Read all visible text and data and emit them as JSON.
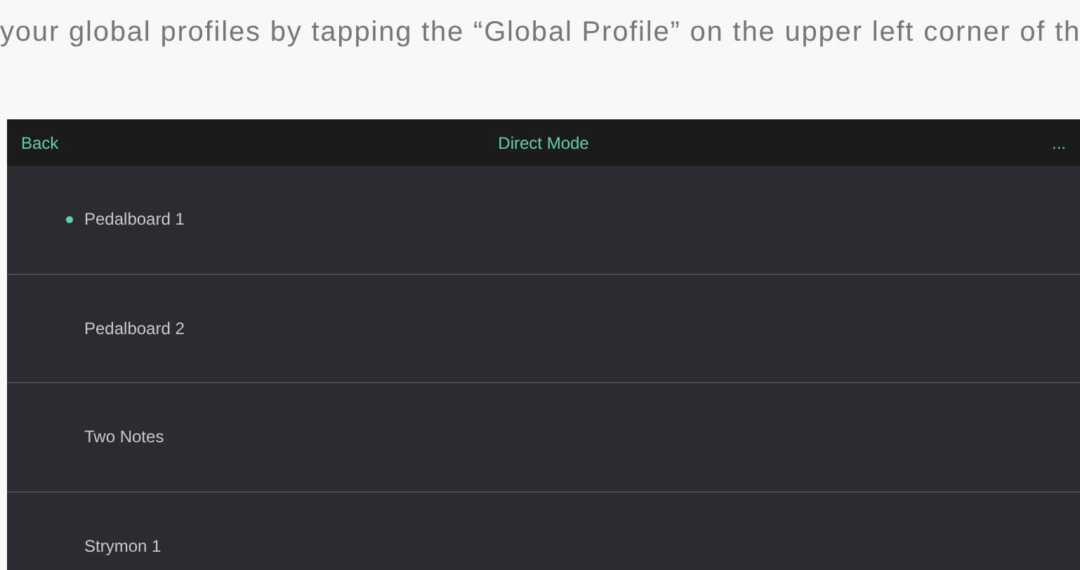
{
  "caption": "your global profiles by tapping the “Global Profile” on the upper left corner of th",
  "header": {
    "back": "Back",
    "title": "Direct Mode",
    "more": "..."
  },
  "profiles": [
    {
      "label": "Pedalboard 1",
      "selected": true
    },
    {
      "label": "Pedalboard 2",
      "selected": false
    },
    {
      "label": "Two Notes",
      "selected": false
    },
    {
      "label": "Strymon 1",
      "selected": false
    }
  ]
}
